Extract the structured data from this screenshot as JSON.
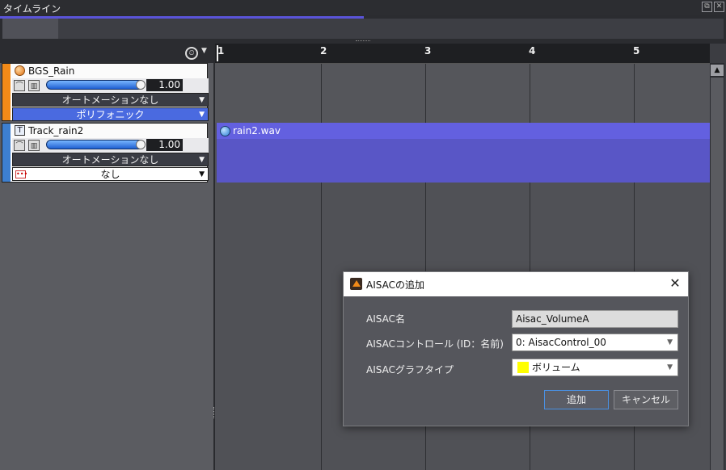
{
  "window": {
    "title": "タイムライン"
  },
  "ruler": {
    "ticks": [
      "1",
      "2",
      "3",
      "4",
      "5"
    ]
  },
  "tracks": [
    {
      "name": "BGS_Rain",
      "volume": "1.00",
      "automation": "オートメーションなし",
      "mode": "ポリフォニック",
      "stripe_color": "#f28a18"
    },
    {
      "name": "Track_rain2",
      "volume": "1.00",
      "automation": "オートメーションなし",
      "mode": "なし",
      "stripe_color": "#3d7fd0"
    }
  ],
  "waveform": {
    "filename": "rain2.wav",
    "color": "#5956c6"
  },
  "dialog": {
    "title": "AISACの追加",
    "close": "✕",
    "fields": {
      "name_label": "AISAC名",
      "name_value": "Aisac_VolumeA",
      "control_label": "AISACコントロール (ID：名前)",
      "control_value": "0: AisacControl_00",
      "graph_label": "AISACグラフタイプ",
      "graph_value": "ボリューム",
      "graph_color": "#ffff00"
    },
    "buttons": {
      "add": "追加",
      "cancel": "キャンセル"
    }
  }
}
